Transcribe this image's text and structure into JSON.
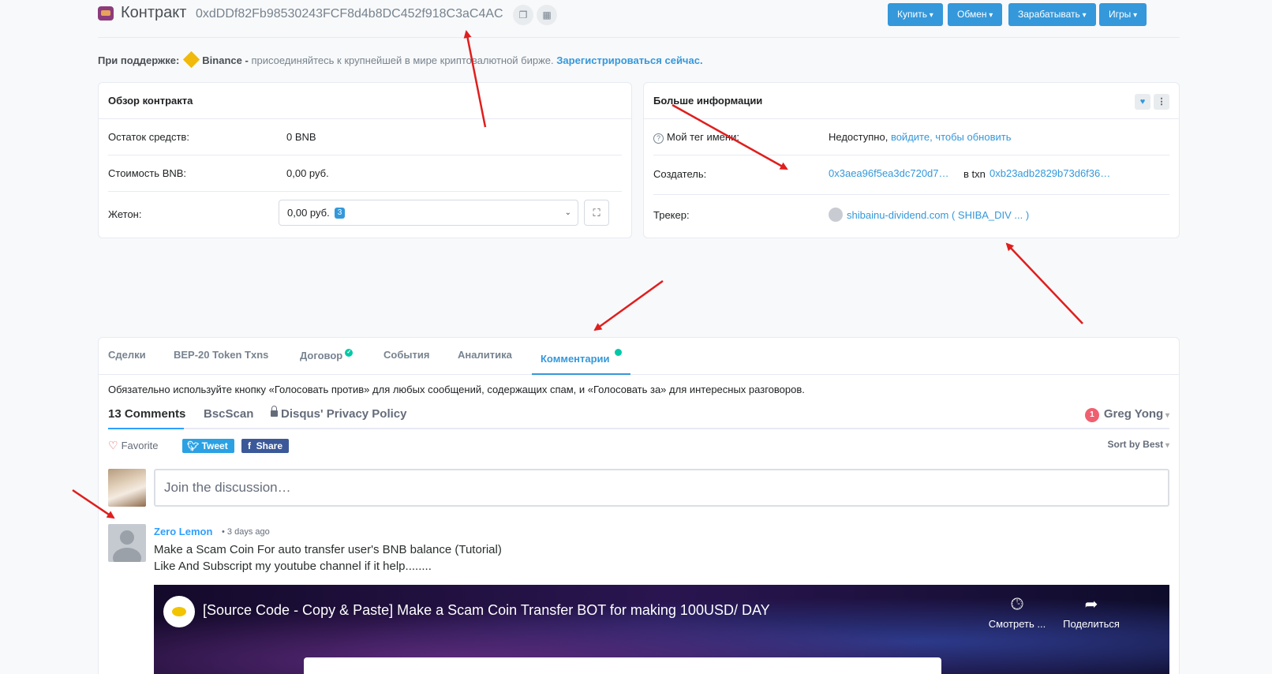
{
  "header": {
    "title": "Контракт",
    "address": "0xdDDf82Fb98530243FCF8d4b8DC452f918C3aC4AC",
    "nav": [
      "Купить",
      "Обмен",
      "Зарабатывать",
      "Игры"
    ]
  },
  "sponsor": {
    "label": "При поддержке:",
    "brand": "Binance -",
    "text": "присоединяйтесь к крупнейшей в мире криптовалютной бирже.",
    "cta": "Зарегистрироваться сейчас."
  },
  "overview": {
    "title": "Обзор контракта",
    "balance_label": "Остаток средств:",
    "balance_value": "0 BNB",
    "value_label": "Стоимость BNB:",
    "value_value": "0,00 руб.",
    "token_label": "Жетон:",
    "token_value": "0,00 руб.",
    "token_count": "3"
  },
  "more_info": {
    "title": "Больше информации",
    "tag_label": "Мой тег имени:",
    "tag_value": "Недоступно,",
    "tag_link": "войдите, чтобы обновить",
    "creator_label": "Создатель:",
    "creator_value": "0x3aea96f5ea3dc720d7…",
    "in_txn": "в txn",
    "txn_value": "0xb23adb2829b73d6f36…",
    "tracker_label": "Трекер:",
    "tracker_value": "shibainu-dividend.com ( SHIBA_DIV ... )"
  },
  "tabs": [
    "Сделки",
    "BEP-20 Token Txns",
    "Договор",
    "События",
    "Аналитика",
    "Комментарии"
  ],
  "active_tab": "Комментарии",
  "comments": {
    "notice": "Обязательно используйте кнопку «Голосовать против» для любых сообщений, содержащих спам, и «Голосовать за» для интересных разговоров.",
    "count_label": "13 Comments",
    "site_label": "BscScan",
    "privacy_label": "Disqus' Privacy Policy",
    "user_badge": "1",
    "user_name": "Greg Yong",
    "favorite_label": "Favorite",
    "tweet_label": "Tweet",
    "share_label": "Share",
    "sort_label": "Sort by Best",
    "join_placeholder": "Join the discussion…",
    "post": {
      "author": "Zero Lemon",
      "time": "• 3 days ago",
      "line1": "Make a Scam Coin For auto transfer user's BNB balance (Tutorial)",
      "line2": "Like And Subscript my youtube channel if it help........"
    },
    "video": {
      "title": "[Source Code - Copy & Paste] Make a Scam Coin Transfer BOT for making 100USD/ DAY",
      "watch_label": "Смотреть ...",
      "share_label": "Поделиться"
    }
  },
  "colors": {
    "accent": "#3498db",
    "annotation_arrow": "#e01e1e",
    "success": "#00c9a7"
  },
  "icons": [
    "contract-logo-icon",
    "copy-icon",
    "qr-icon",
    "binance-icon",
    "expand-icon",
    "heart-icon",
    "more-icon",
    "question-icon",
    "token-icon",
    "check-icon",
    "lock-icon",
    "clock-icon",
    "share-arrow-icon"
  ]
}
